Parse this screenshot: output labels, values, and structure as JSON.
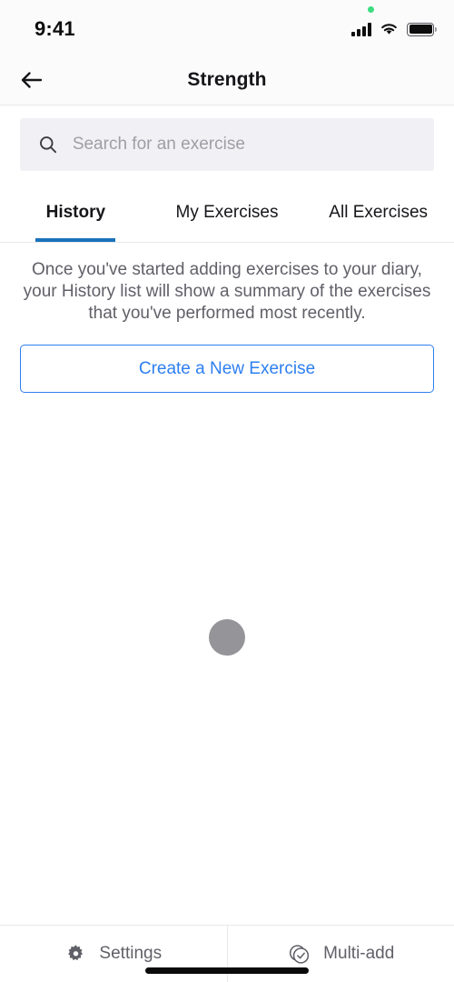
{
  "status_bar": {
    "time": "9:41",
    "signal_icon": "cellular-signal-icon",
    "wifi_icon": "wifi-icon",
    "battery_icon": "battery-full-icon",
    "recording_dot": "green-status-dot"
  },
  "header": {
    "back_icon": "back-arrow-icon",
    "title": "Strength"
  },
  "search": {
    "icon": "search-icon",
    "placeholder": "Search for an exercise",
    "value": ""
  },
  "tabs": {
    "active_index": 0,
    "items": [
      {
        "label": "History",
        "active": true
      },
      {
        "label": "My Exercises",
        "active": false
      },
      {
        "label": "All Exercises",
        "active": false
      }
    ]
  },
  "content": {
    "empty_state_text": "Once you've started adding exercises to your diary, your History list will show a summary of the exercises that you've performed most recently.",
    "create_button_label": "Create a New Exercise",
    "loading_indicator": "loading-circle-placeholder"
  },
  "bottom_bar": {
    "items": [
      {
        "label": "Settings",
        "icon": "gear-icon"
      },
      {
        "label": "Multi-add",
        "icon": "check-circle-stack-icon"
      }
    ],
    "home_indicator": "home-indicator-bar"
  },
  "colors": {
    "accent_blue": "#2d7ff0",
    "tab_underline": "#1a72ba",
    "text_primary": "#16161a",
    "text_secondary": "#606068",
    "search_bg": "#f1f1f5",
    "status_green": "#3ddc7f"
  }
}
